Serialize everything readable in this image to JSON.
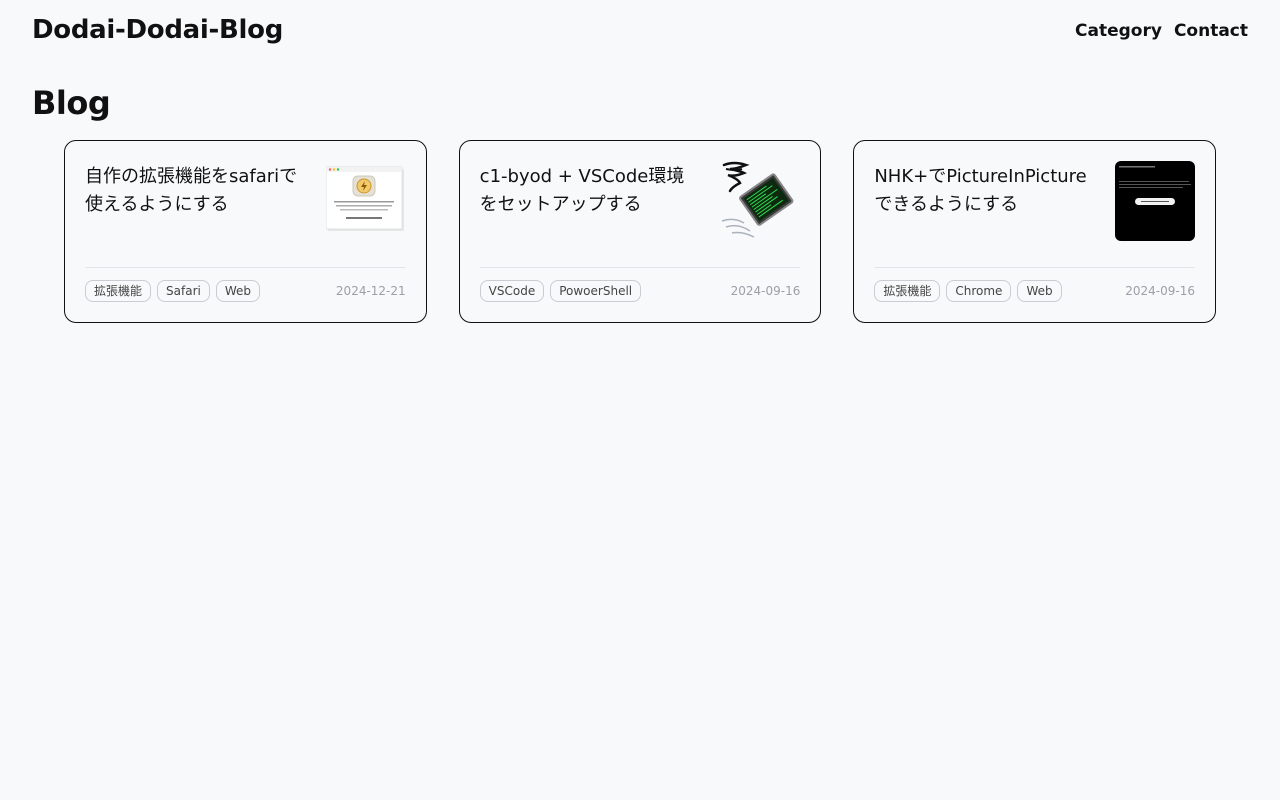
{
  "header": {
    "site_title": "Dodai-Dodai-Blog",
    "nav": [
      {
        "label": "Category"
      },
      {
        "label": "Contact"
      }
    ]
  },
  "page_title": "Blog",
  "posts": [
    {
      "title": "自作の拡張機能をsafariで使えるようにする",
      "tags": [
        "拡張機能",
        "Safari",
        "Web"
      ],
      "date": "2024-12-21",
      "thumbnail": "safari-extension-dialog-image"
    },
    {
      "title": "c1-byod + VSCode環境をセットアップする",
      "tags": [
        "VSCode",
        "PowoerShell"
      ],
      "date": "2024-09-16",
      "thumbnail": "terminal-tornado-illustration"
    },
    {
      "title": "NHK+でPictureInPictureできるようにする",
      "tags": [
        "拡張機能",
        "Chrome",
        "Web"
      ],
      "date": "2024-09-16",
      "thumbnail": "dark-pip-dialog-image"
    }
  ],
  "colors": {
    "background": "#f8f9fb",
    "text": "#111111",
    "card_border": "#111111",
    "tag_border": "#c9ccd1",
    "date": "#9aa0a6"
  }
}
